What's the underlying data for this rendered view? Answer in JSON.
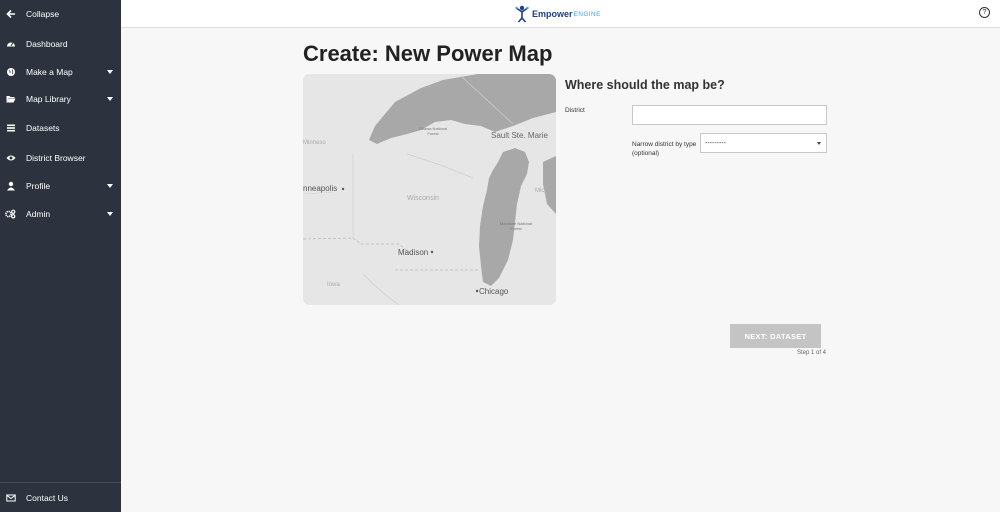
{
  "sidebar": {
    "items": [
      {
        "label": "Collapse",
        "icon": "arrow-left-icon",
        "caret": false
      },
      {
        "label": "Dashboard",
        "icon": "dashboard-icon",
        "caret": false
      },
      {
        "label": "Make a Map",
        "icon": "globe-icon",
        "caret": true
      },
      {
        "label": "Map Library",
        "icon": "folder-open-icon",
        "caret": true
      },
      {
        "label": "Datasets",
        "icon": "list-icon",
        "caret": false
      },
      {
        "label": "District Browser",
        "icon": "eye-icon",
        "caret": false
      },
      {
        "label": "Profile",
        "icon": "user-icon",
        "caret": true
      },
      {
        "label": "Admin",
        "icon": "gears-icon",
        "caret": true
      }
    ],
    "footer": {
      "label": "Contact Us",
      "icon": "envelope-icon"
    }
  },
  "header": {
    "logo_text": "Empower",
    "logo_sub": "ENGINE",
    "help_symbol": "?"
  },
  "main": {
    "title": "Create: New Power Map",
    "map_labels": {
      "ottawa": [
        "Ottawa National",
        "Forest"
      ],
      "sault": "Sault Ste. Marie",
      "minnesota": "Minneso",
      "minneapolis": "nneapolis",
      "wisconsin": "Wisconsin",
      "michigan": "Michig",
      "manistee": [
        "Manistee National",
        "Forest"
      ],
      "madison": "Madison",
      "iowa": "Iowa",
      "chicago": "Chicago"
    },
    "form": {
      "heading": "Where should the map be?",
      "district_label": "District",
      "district_value": "",
      "narrow_label": "Narrow district by type (optional)",
      "narrow_selected": "---------"
    },
    "next_button": "NEXT: DATASET",
    "step_text": "Step 1 of 4"
  },
  "colors": {
    "sidebar_bg": "#2c323e",
    "water": "#a8a8a8",
    "land": "#e6e6e6",
    "button_disabled": "#c4c4c4",
    "logo_primary": "#1c3f8f",
    "logo_accent": "#4aa3d8"
  }
}
